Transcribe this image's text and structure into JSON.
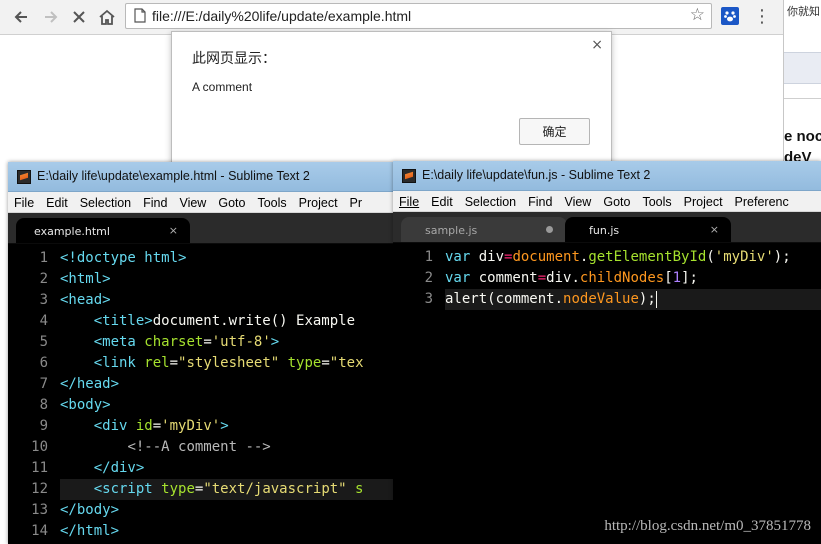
{
  "browser": {
    "url": "file:///E:/daily%20life/update/example.html",
    "icons": {
      "back": "arrow-left-icon",
      "forward": "arrow-right-icon",
      "stop": "close-icon",
      "home": "home-icon",
      "bookmark": "star-icon",
      "extension": "paw-icon",
      "menu": "more-vertical-icon"
    }
  },
  "background_window": {
    "top_text": "你就知",
    "line1": "e noc",
    "line2": "deV"
  },
  "alert": {
    "title": "此网页显示：",
    "message": "A comment",
    "ok_label": "确定",
    "close_glyph": "×"
  },
  "left_editor": {
    "title": "E:\\daily life\\update\\example.html - Sublime Text 2",
    "menu": [
      "File",
      "Edit",
      "Selection",
      "Find",
      "View",
      "Goto",
      "Tools",
      "Project",
      "Pr"
    ],
    "tabs": [
      {
        "label": "example.html",
        "state": "active",
        "close": "×"
      }
    ],
    "line_numbers": [
      "1",
      "2",
      "3",
      "4",
      "5",
      "6",
      "7",
      "8",
      "9",
      "10",
      "11",
      "12",
      "13",
      "14"
    ],
    "lines": [
      [
        {
          "t": "<!doctype html>",
          "c": "tag"
        }
      ],
      [
        {
          "t": "<html>",
          "c": "tag"
        }
      ],
      [
        {
          "t": "<head>",
          "c": "tag"
        }
      ],
      [
        {
          "t": "    ",
          "c": "txt"
        },
        {
          "t": "<title>",
          "c": "tag"
        },
        {
          "t": "document.write() Example",
          "c": "txt"
        }
      ],
      [
        {
          "t": "    ",
          "c": "txt"
        },
        {
          "t": "<meta ",
          "c": "tag"
        },
        {
          "t": "charset",
          "c": "attr"
        },
        {
          "t": "=",
          "c": "txt"
        },
        {
          "t": "'utf-8'",
          "c": "str"
        },
        {
          "t": ">",
          "c": "tag"
        }
      ],
      [
        {
          "t": "    ",
          "c": "txt"
        },
        {
          "t": "<link ",
          "c": "tag"
        },
        {
          "t": "rel",
          "c": "attr"
        },
        {
          "t": "=",
          "c": "txt"
        },
        {
          "t": "\"stylesheet\"",
          "c": "str"
        },
        {
          "t": " ",
          "c": "txt"
        },
        {
          "t": "type",
          "c": "attr"
        },
        {
          "t": "=",
          "c": "txt"
        },
        {
          "t": "\"tex",
          "c": "str"
        }
      ],
      [
        {
          "t": "</head>",
          "c": "tag"
        }
      ],
      [
        {
          "t": "<body>",
          "c": "tag"
        }
      ],
      [
        {
          "t": "    ",
          "c": "txt"
        },
        {
          "t": "<div ",
          "c": "tag"
        },
        {
          "t": "id",
          "c": "attr"
        },
        {
          "t": "=",
          "c": "txt"
        },
        {
          "t": "'myDiv'",
          "c": "str"
        },
        {
          "t": ">",
          "c": "tag"
        }
      ],
      [
        {
          "t": "        ",
          "c": "txt"
        },
        {
          "t": "<!--A comment -->",
          "c": "com"
        }
      ],
      [
        {
          "t": "    ",
          "c": "txt"
        },
        {
          "t": "</div>",
          "c": "tag"
        }
      ],
      [
        {
          "t": "    ",
          "c": "txt"
        },
        {
          "t": "<script ",
          "c": "tag"
        },
        {
          "t": "type",
          "c": "attr"
        },
        {
          "t": "=",
          "c": "txt"
        },
        {
          "t": "\"text/javascript\"",
          "c": "str"
        },
        {
          "t": " s",
          "c": "attr"
        }
      ],
      [
        {
          "t": "</body>",
          "c": "tag"
        }
      ],
      [
        {
          "t": "</html>",
          "c": "tag"
        }
      ]
    ],
    "current_line": 12
  },
  "right_editor": {
    "title": "E:\\daily life\\update\\fun.js - Sublime Text 2",
    "menu": [
      "File",
      "Edit",
      "Selection",
      "Find",
      "View",
      "Goto",
      "Tools",
      "Project",
      "Preferenc"
    ],
    "tabs": [
      {
        "label": "sample.js",
        "state": "inactive",
        "modified": true
      },
      {
        "label": "fun.js",
        "state": "active",
        "close": "×"
      }
    ],
    "line_numbers": [
      "1",
      "2",
      "3"
    ],
    "lines": [
      [
        {
          "t": "var ",
          "c": "kw"
        },
        {
          "t": "div",
          "c": "id"
        },
        {
          "t": "=",
          "c": "op"
        },
        {
          "t": "document",
          "c": "prop"
        },
        {
          "t": ".",
          "c": "id"
        },
        {
          "t": "getElementById",
          "c": "fn"
        },
        {
          "t": "(",
          "c": "id"
        },
        {
          "t": "'myDiv'",
          "c": "str"
        },
        {
          "t": ");",
          "c": "id"
        }
      ],
      [
        {
          "t": "var ",
          "c": "kw"
        },
        {
          "t": "comment",
          "c": "id"
        },
        {
          "t": "=",
          "c": "op"
        },
        {
          "t": "div.",
          "c": "id"
        },
        {
          "t": "childNodes",
          "c": "prop"
        },
        {
          "t": "[",
          "c": "id"
        },
        {
          "t": "1",
          "c": "num"
        },
        {
          "t": "];",
          "c": "id"
        }
      ],
      [
        {
          "t": "alert",
          "c": "id"
        },
        {
          "t": "(",
          "c": "id"
        },
        {
          "t": "comment.",
          "c": "id"
        },
        {
          "t": "nodeValue",
          "c": "prop"
        },
        {
          "t": ");",
          "c": "id"
        }
      ]
    ],
    "current_line": 3,
    "watermark": "http://blog.csdn.net/m0_37851778"
  }
}
